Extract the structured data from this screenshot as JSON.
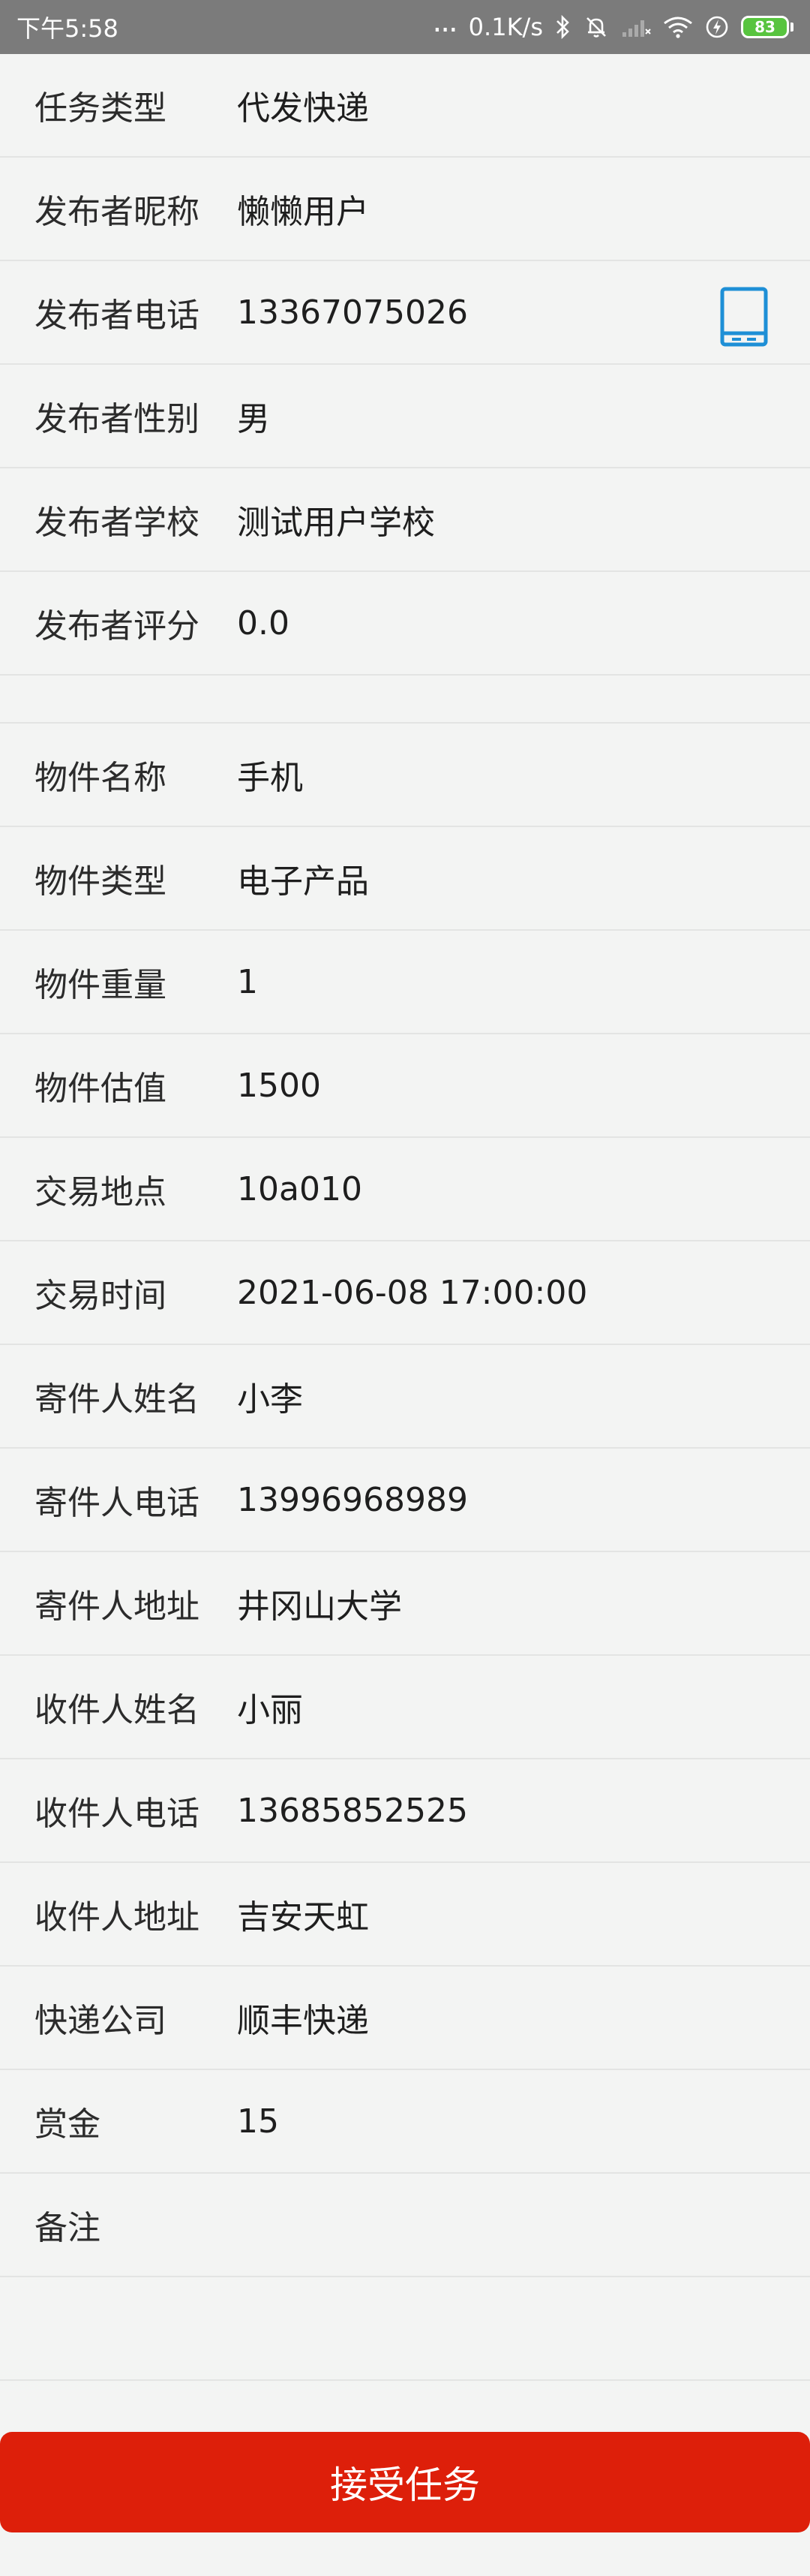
{
  "status_bar": {
    "time": "下午5:58",
    "dots": "...",
    "speed": "0.1K/s",
    "battery": "83",
    "colors": {
      "background": "#7b7b7b",
      "battery_fill": "#58c43f"
    }
  },
  "publisher": [
    {
      "label": "任务类型",
      "value": "代发快递"
    },
    {
      "label": "发布者昵称",
      "value": "懒懒用户"
    },
    {
      "label": "发布者电话",
      "value": "13367075026",
      "icon": "phone-icon"
    },
    {
      "label": "发布者性别",
      "value": "男"
    },
    {
      "label": "发布者学校",
      "value": "测试用户学校"
    },
    {
      "label": "发布者评分",
      "value": "0.0"
    }
  ],
  "item": [
    {
      "label": "物件名称",
      "value": "手机"
    },
    {
      "label": "物件类型",
      "value": "电子产品"
    },
    {
      "label": "物件重量",
      "value": "1"
    },
    {
      "label": "物件估值",
      "value": "1500"
    },
    {
      "label": "交易地点",
      "value": "10a010"
    },
    {
      "label": "交易时间",
      "value": "2021-06-08 17:00:00"
    },
    {
      "label": "寄件人姓名",
      "value": "小李"
    },
    {
      "label": "寄件人电话",
      "value": "13996968989"
    },
    {
      "label": "寄件人地址",
      "value": "井冈山大学"
    },
    {
      "label": "收件人姓名",
      "value": "小丽"
    },
    {
      "label": "收件人电话",
      "value": "13685852525"
    },
    {
      "label": "收件人地址",
      "value": "吉安天虹"
    },
    {
      "label": "快递公司",
      "value": "顺丰快递"
    },
    {
      "label": "赏金",
      "value": "15"
    },
    {
      "label": "备注",
      "value": ""
    }
  ],
  "accept_button": {
    "label": "接受任务",
    "color": "#dd1f0a"
  },
  "accent_icon_color": "#1e8fd6"
}
